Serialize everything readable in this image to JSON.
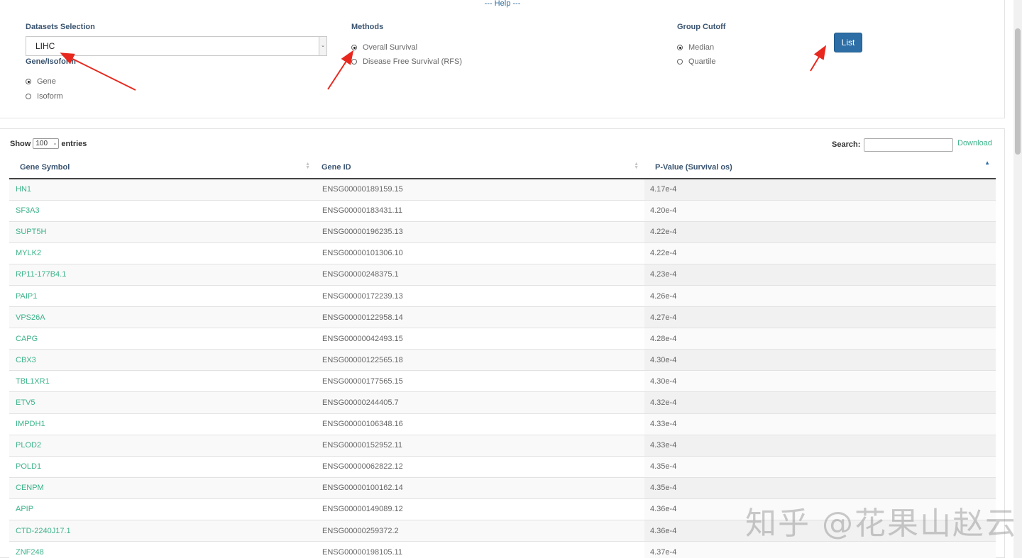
{
  "help_text": "--- Help ---",
  "datasets": {
    "label": "Datasets Selection",
    "selected": "LIHC"
  },
  "gene_isoform": {
    "label": "Gene/Isoform",
    "options": [
      {
        "label": "Gene",
        "checked": true
      },
      {
        "label": "Isoform",
        "checked": false
      }
    ]
  },
  "methods": {
    "label": "Methods",
    "options": [
      {
        "label": "Overall Survival",
        "checked": true
      },
      {
        "label": "Disease Free Survival (RFS)",
        "checked": false
      }
    ]
  },
  "group_cutoff": {
    "label": "Group Cutoff",
    "options": [
      {
        "label": "Median",
        "checked": true
      },
      {
        "label": "Quartile",
        "checked": false
      }
    ]
  },
  "list_button": "List",
  "table_controls": {
    "show": "Show",
    "entries_value": "100",
    "entries": "entries",
    "search_label": "Search:",
    "download": "Download"
  },
  "table": {
    "columns": [
      "Gene Symbol",
      "Gene ID",
      "P-Value (Survival os)"
    ],
    "rows": [
      [
        "HN1",
        "ENSG00000189159.15",
        "4.17e-4"
      ],
      [
        "SF3A3",
        "ENSG00000183431.11",
        "4.20e-4"
      ],
      [
        "SUPT5H",
        "ENSG00000196235.13",
        "4.22e-4"
      ],
      [
        "MYLK2",
        "ENSG00000101306.10",
        "4.22e-4"
      ],
      [
        "RP11-177B4.1",
        "ENSG00000248375.1",
        "4.23e-4"
      ],
      [
        "PAIP1",
        "ENSG00000172239.13",
        "4.26e-4"
      ],
      [
        "VPS26A",
        "ENSG00000122958.14",
        "4.27e-4"
      ],
      [
        "CAPG",
        "ENSG00000042493.15",
        "4.28e-4"
      ],
      [
        "CBX3",
        "ENSG00000122565.18",
        "4.30e-4"
      ],
      [
        "TBL1XR1",
        "ENSG00000177565.15",
        "4.30e-4"
      ],
      [
        "ETV5",
        "ENSG00000244405.7",
        "4.32e-4"
      ],
      [
        "IMPDH1",
        "ENSG00000106348.16",
        "4.33e-4"
      ],
      [
        "PLOD2",
        "ENSG00000152952.11",
        "4.33e-4"
      ],
      [
        "POLD1",
        "ENSG00000062822.12",
        "4.35e-4"
      ],
      [
        "CENPM",
        "ENSG00000100162.14",
        "4.35e-4"
      ],
      [
        "APIP",
        "ENSG00000149089.12",
        "4.36e-4"
      ],
      [
        "CTD-2240J17.1",
        "ENSG00000259372.2",
        "4.36e-4"
      ],
      [
        "ZNF248",
        "ENSG00000198105.11",
        "4.37e-4"
      ]
    ]
  },
  "watermark": "知乎 @花果山赵云",
  "colors": {
    "link": "#3cb389",
    "button": "#2d6ea6",
    "annotation_arrow": "#e8281e"
  }
}
